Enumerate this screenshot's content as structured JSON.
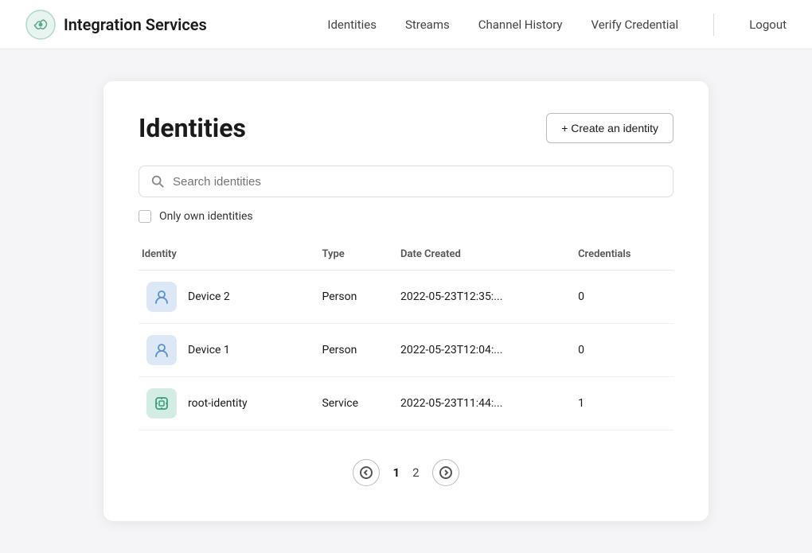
{
  "nav": {
    "brand": "Integration Services",
    "links": [
      {
        "label": "Identities",
        "id": "identities"
      },
      {
        "label": "Streams",
        "id": "streams"
      },
      {
        "label": "Channel History",
        "id": "channel-history"
      },
      {
        "label": "Verify Credential",
        "id": "verify-credential"
      }
    ],
    "logout_label": "Logout"
  },
  "page": {
    "title": "Identities",
    "create_button": "+ Create an identity",
    "search_placeholder": "Search identities",
    "only_own_label": "Only own identities"
  },
  "table": {
    "columns": [
      "Identity",
      "Type",
      "Date Created",
      "Credentials"
    ],
    "rows": [
      {
        "icon_type": "person",
        "name": "Device 2",
        "type": "Person",
        "date_created": "2022-05-23T12:35:...",
        "credentials": "0"
      },
      {
        "icon_type": "person",
        "name": "Device 1",
        "type": "Person",
        "date_created": "2022-05-23T12:04:...",
        "credentials": "0"
      },
      {
        "icon_type": "service",
        "name": "root-identity",
        "type": "Service",
        "date_created": "2022-05-23T11:44:...",
        "credentials": "1"
      }
    ]
  },
  "pagination": {
    "current": 1,
    "total": 2,
    "pages": [
      "1",
      "2"
    ]
  }
}
